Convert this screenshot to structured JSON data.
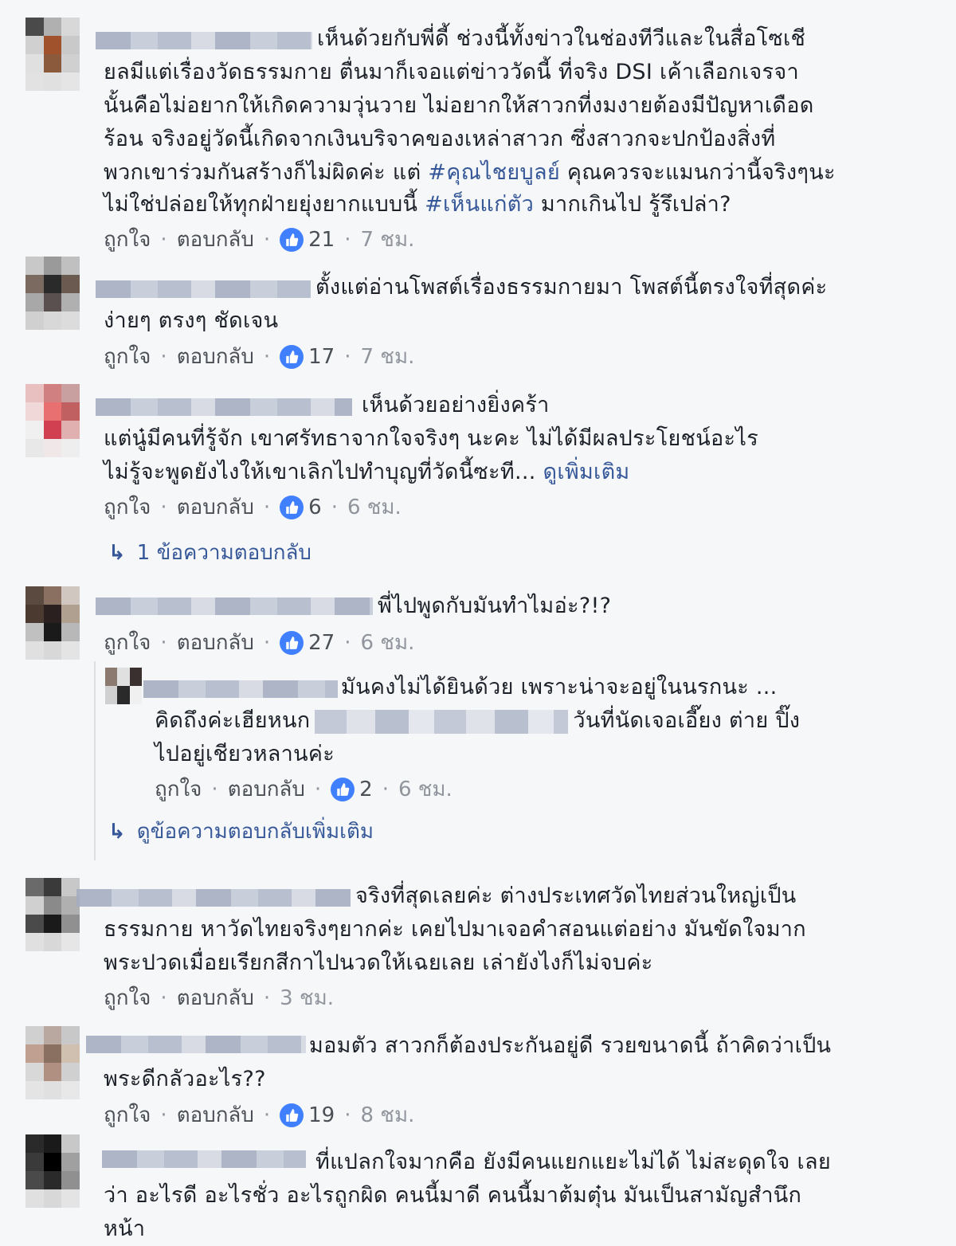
{
  "actions": {
    "like": "ถูกใจ",
    "reply": "ตอบกลับ",
    "sep": "·"
  },
  "comments": [
    {
      "lines": [
        "เห็นด้วยกับพี่ดี้ ช่วงนี้ทั้งข่าวในช่องทีวีและในสื่อโซเชี",
        "ยลมีแต่เรื่องวัดธรรมกาย ตื่นมาก็เจอแต่ข่าววัดนี้ ที่จริง DSI เค้าเลือกเจรจา",
        "นั้นคือไม่อยากให้เกิดความวุ่นวาย ไม่อยากให้สาวกที่งมงายต้องมีปัญหาเดือด",
        "ร้อน จริงอยู่วัดนี้เกิดจากเงินบริจาคของเหล่าสาวก ซึ่งสาวกจะปกป้องสิ่งที่"
      ],
      "line5_pre": "พวกเขาร่วมกันสร้างก็ไม่ผิดค่ะ แต่ ",
      "line5_tag": "#คุณไชยบูลย์",
      "line5_post": " คุณควรจะแมนกว่านี้จริงๆนะ",
      "line6_pre": "ไม่ใช่ปล่อยให้ทุกฝ่ายยุ่งยากแบบนี้ ",
      "line6_tag": "#เห็นแก่ตัว",
      "line6_post": " มากเกินไป รู้รึเปล่า?",
      "likes": "21",
      "time": "7 ชม."
    },
    {
      "lines": [
        "ตั้งแต่อ่านโพสต์เรื่องธรรมกายมา โพสต์นี้ตรงใจที่สุดค่ะ",
        "ง่ายๆ ตรงๆ ชัดเจน"
      ],
      "likes": "17",
      "time": "7 ชม."
    },
    {
      "lines": [
        "เห็นด้วยอย่างยิ่งคร้า",
        "แต่นู๋มีคนที่รู้จัก เขาศรัทธาจากใจจริงๆ นะคะ ไม่ได้มีผลประโยชน์อะไร",
        "ไม่รู้จะพูดยังไงให้เขาเลิกไปทำบุญที่วัดนี้ซะที... "
      ],
      "more": "ดูเพิ่มเติม",
      "likes": "6",
      "time": "6 ชม.",
      "replies_link": "1 ข้อความตอบกลับ"
    },
    {
      "lines": [
        "พี่ไปพูดกับมันทำไมอ่ะ?!?"
      ],
      "likes": "27",
      "time": "6 ชม.",
      "reply": {
        "line1": "มันคงไม่ได้ยินด้วย เพราะน่าจะอยู่ในนรกนะ ...",
        "line2_pre": "คิดถึงค่ะเฮียหนก",
        "line2_post": "วันที่นัดเจอเอี๊ยง ต่าย ปิ๊ง",
        "line3": "ไปอยู่เชียวหลานค่ะ",
        "likes": "2",
        "time": "6 ชม."
      },
      "more_replies_link": "ดูข้อความตอบกลับเพิ่มเติม"
    },
    {
      "lines": [
        "จริงที่สุดเลยค่ะ ต่างประเทศวัดไทยส่วนใหญ่เป็น",
        "ธรรมกาย หาวัดไทยจริงๆยากค่ะ เคยไปมาเจอคำสอนแต่อย่าง มันขัดใจมาก",
        "พระปวดเมื่อยเรียกสีกาไปนวดให้เฉยเลย เล่ายังไงก็ไม่จบค่ะ"
      ],
      "time": "3 ชม."
    },
    {
      "lines": [
        "มอมตัว สาวกก็ต้องประกันอยู่ดี รวยขนาดนี้ ถ้าคิดว่าเป็น",
        "พระดีกลัวอะไร??"
      ],
      "likes": "19",
      "time": "8 ชม."
    },
    {
      "lines": [
        "ที่แปลกใจมากคือ ยังมีคนแยกแยะไม่ได้ ไม่สะดุดใจ เลย",
        "ว่า อะไรดี อะไรชั่ว อะไรถูกผิด คนนี้มาดี คนนี้มาต้มตุ๋น มันเป็นสามัญสำนึก",
        "หน้า"
      ]
    }
  ],
  "avatar_colors": [
    [
      "#4a4a4a",
      "#b0b0b0",
      "#d8d8d8",
      "#d0d0d0",
      "#a0522d",
      "#c9c9c9",
      "#e0e0e0",
      "#8b5a3c",
      "#d0d0d0",
      "#e2e2e2",
      "#e0e0e0",
      "#e5e5e5"
    ],
    [
      "#c8c8c8",
      "#9a9a9a",
      "#c0c0c0",
      "#7a6a60",
      "#2a2a2a",
      "#6a5a50",
      "#a8a8a8",
      "#5a5050",
      "#b0b0b0",
      "#d0d0d0",
      "#d8d8d8",
      "#dcdcdc"
    ],
    [
      "#e8c0c0",
      "#d08080",
      "#c8a0a0",
      "#f0d8d8",
      "#e87070",
      "#c06060",
      "#f0f0f0",
      "#d04050",
      "#e0b0b0",
      "#e8e8e8",
      "#f0e8e8",
      "#eeeeee"
    ],
    [
      "#5a4a40",
      "#8a7060",
      "#d0c8c0",
      "#4a3a30",
      "#2a2020",
      "#b0a090",
      "#c0c0c0",
      "#1a1a1a",
      "#b8b8b8",
      "#e0e0e0",
      "#d8d8d8",
      "#e4e4e4"
    ],
    [
      "#6a6a6a",
      "#3a3a3a",
      "#c8c8c8",
      "#d0d0d0",
      "#8a8a8a",
      "#b0b0b0",
      "#4a4a4a",
      "#1a1a1a",
      "#909090",
      "#e0e0e0",
      "#d8d8d8",
      "#e6e6e6"
    ],
    [
      "#d0d0d0",
      "#b8a8a0",
      "#c8c8c8",
      "#c0a090",
      "#8a7060",
      "#d0c0b0",
      "#d8d8d8",
      "#b09080",
      "#d0d0d0",
      "#e4e4e4",
      "#e0e0e0",
      "#e8e8e8"
    ],
    [
      "#2a2a2a",
      "#1a1a1a",
      "#c8c8c8",
      "#3a3a3a",
      "#000000",
      "#a0a0a0",
      "#4a4a4a",
      "#2a2a2a",
      "#909090",
      "#e0e0e0",
      "#d8d8d8",
      "#e4e4e4"
    ]
  ],
  "reply_avatar_colors": [
    "#8a7a70",
    "#e0e0e0",
    "#3a3030",
    "#d0d0d0",
    "#2a2a2a",
    "#f0f0f0"
  ],
  "like_icon_color": "#4080ff",
  "link_color": "#365899"
}
